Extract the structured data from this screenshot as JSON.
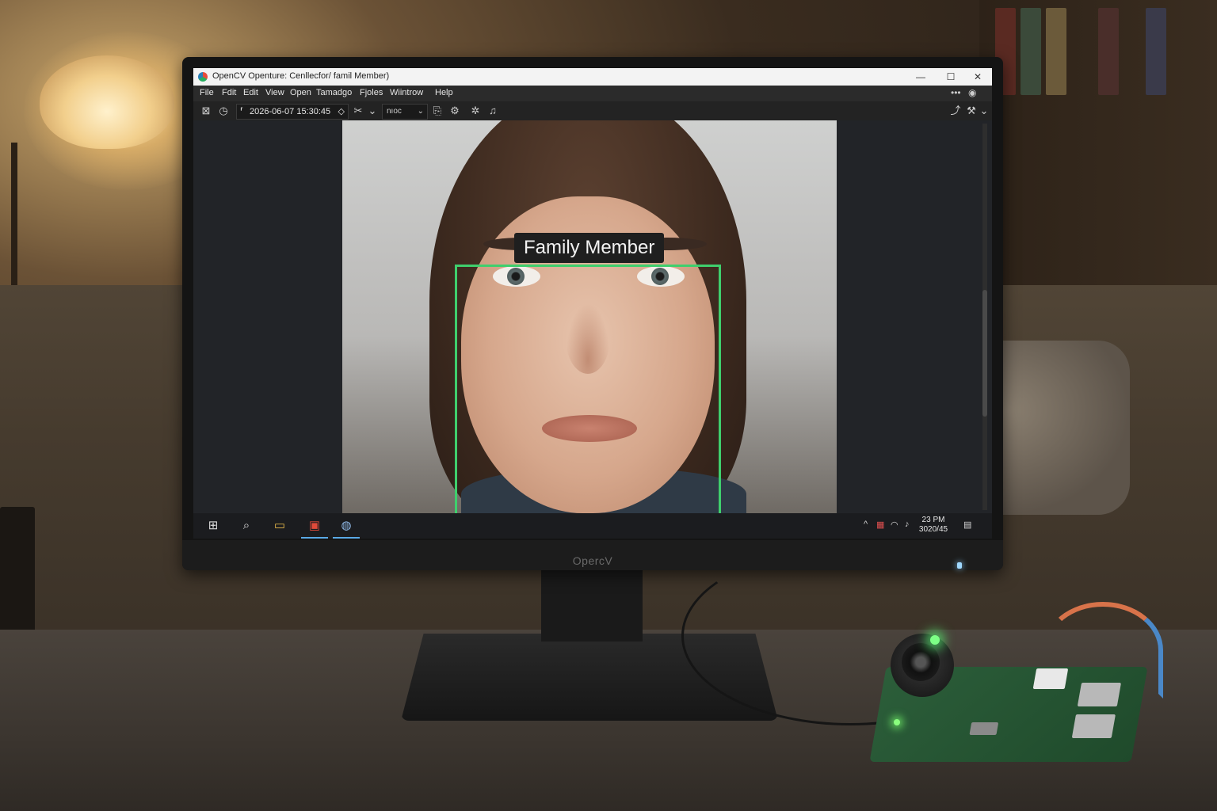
{
  "window": {
    "title": "OpenCV Openture: Cenllecfor/ famil Member)",
    "controls": {
      "minimize": "—",
      "maximize": "☐",
      "close": "✕"
    }
  },
  "menu": {
    "items": [
      "File",
      "Fdit",
      "Edit",
      "View",
      "Open",
      "Tamadgo",
      "Fjoles",
      "Wiintrow",
      "Help"
    ],
    "extra": "•••"
  },
  "toolbar": {
    "timestamp": "2026-06-07 15:30:45",
    "select_value": "nıoc"
  },
  "detection": {
    "label": "Family Member",
    "box_color": "#3fcf6d"
  },
  "monitor": {
    "brand": "OpercV"
  },
  "taskbar": {
    "clock_time": "23 PM",
    "clock_date": "3020/45"
  },
  "icons": {
    "start": "windows-start-icon",
    "search": "search-icon",
    "folder": "file-explorer-icon",
    "store": "store-icon",
    "app": "opencv-app-icon"
  }
}
